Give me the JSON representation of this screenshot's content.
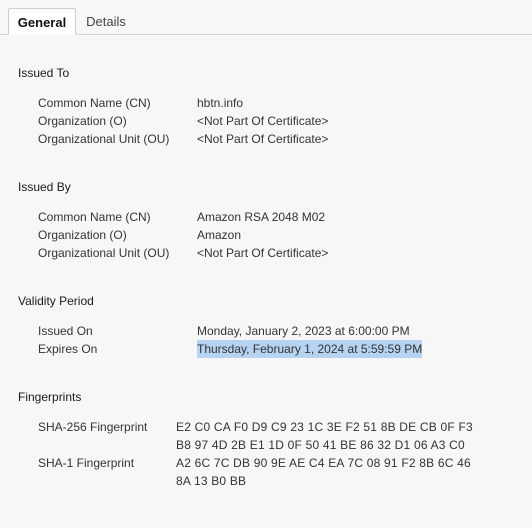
{
  "tabs": {
    "general": "General",
    "details": "Details"
  },
  "issued_to": {
    "title": "Issued To",
    "rows": [
      {
        "label": "Common Name (CN)",
        "value": "hbtn.info"
      },
      {
        "label": "Organization (O)",
        "value": "<Not Part Of Certificate>"
      },
      {
        "label": "Organizational Unit (OU)",
        "value": "<Not Part Of Certificate>"
      }
    ]
  },
  "issued_by": {
    "title": "Issued By",
    "rows": [
      {
        "label": "Common Name (CN)",
        "value": "Amazon RSA 2048 M02"
      },
      {
        "label": "Organization (O)",
        "value": "Amazon"
      },
      {
        "label": "Organizational Unit (OU)",
        "value": "<Not Part Of Certificate>"
      }
    ]
  },
  "validity": {
    "title": "Validity Period",
    "rows": [
      {
        "label": "Issued On",
        "value": "Monday, January 2, 2023 at 6:00:00 PM"
      },
      {
        "label": "Expires On",
        "value": "Thursday, February 1, 2024 at 5:59:59 PM"
      }
    ]
  },
  "fingerprints": {
    "title": "Fingerprints",
    "rows": [
      {
        "label": "SHA-256 Fingerprint",
        "line1": "E2 C0 CA F0 D9 C9 23 1C 3E F2 51 8B DE CB 0F F3",
        "line2": "B8 97 4D 2B E1 1D 0F 50 41 BE 86 32 D1 06 A3 C0"
      },
      {
        "label": "SHA-1 Fingerprint",
        "line1": "A2 6C 7C DB 90 9E AE C4 EA 7C 08 91 F2 8B 6C 46",
        "line2": "8A 13 B0 BB"
      }
    ]
  },
  "colors": {
    "background": "#f7f7f7",
    "selection_highlight": "#b7d3f2",
    "tab_border": "#cfcfcf"
  }
}
